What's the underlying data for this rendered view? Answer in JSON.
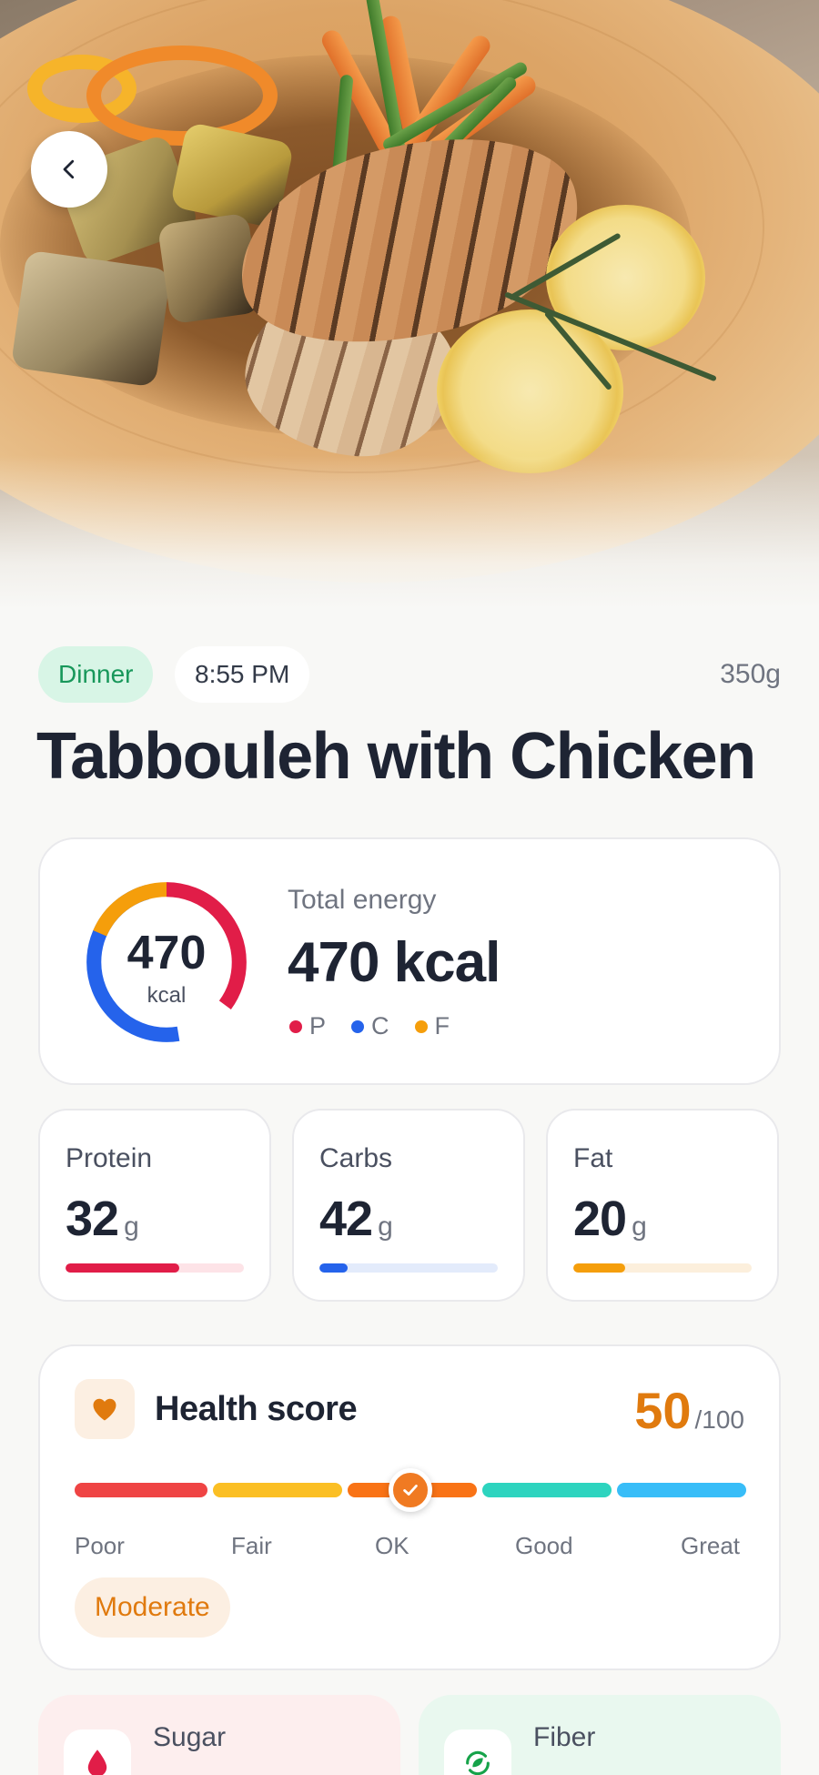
{
  "hero": {
    "back_icon": "chevron-left-icon"
  },
  "meal": {
    "type": "Dinner",
    "time": "8:55 PM",
    "weight": "350g",
    "name": "Tabbouleh with Chicken"
  },
  "energy": {
    "ring_value": "470",
    "ring_unit": "kcal",
    "label": "Total energy",
    "value": "470 kcal",
    "legend": [
      {
        "key": "P",
        "color": "#e11d48"
      },
      {
        "key": "C",
        "color": "#2563eb"
      },
      {
        "key": "F",
        "color": "#f59e0b"
      }
    ]
  },
  "macros": [
    {
      "label": "Protein",
      "value": "32",
      "unit": "g",
      "color": "#e11d48",
      "track": "#fde3e7",
      "fill_fraction": 0.64
    },
    {
      "label": "Carbs",
      "value": "42",
      "unit": "g",
      "color": "#2563eb",
      "track": "#e3ebfb",
      "fill_fraction": 0.16
    },
    {
      "label": "Fat",
      "value": "20",
      "unit": "g",
      "color": "#f59e0b",
      "track": "#fcefdc",
      "fill_fraction": 0.29
    }
  ],
  "health": {
    "title": "Health score",
    "score": "50",
    "max": "/100",
    "icon": "heart-icon",
    "scale": [
      "Poor",
      "Fair",
      "OK",
      "Good",
      "Great"
    ],
    "scale_colors": [
      "#ef4444",
      "#fbbf24",
      "#f97316",
      "#2dd4bf",
      "#38bdf8"
    ],
    "score_fraction": 0.5,
    "rating": "Moderate"
  },
  "extras": [
    {
      "label": "Sugar",
      "value": "",
      "icon": "drop-icon"
    },
    {
      "label": "Fiber",
      "value": "",
      "icon": "leaf-cycle-icon"
    }
  ]
}
